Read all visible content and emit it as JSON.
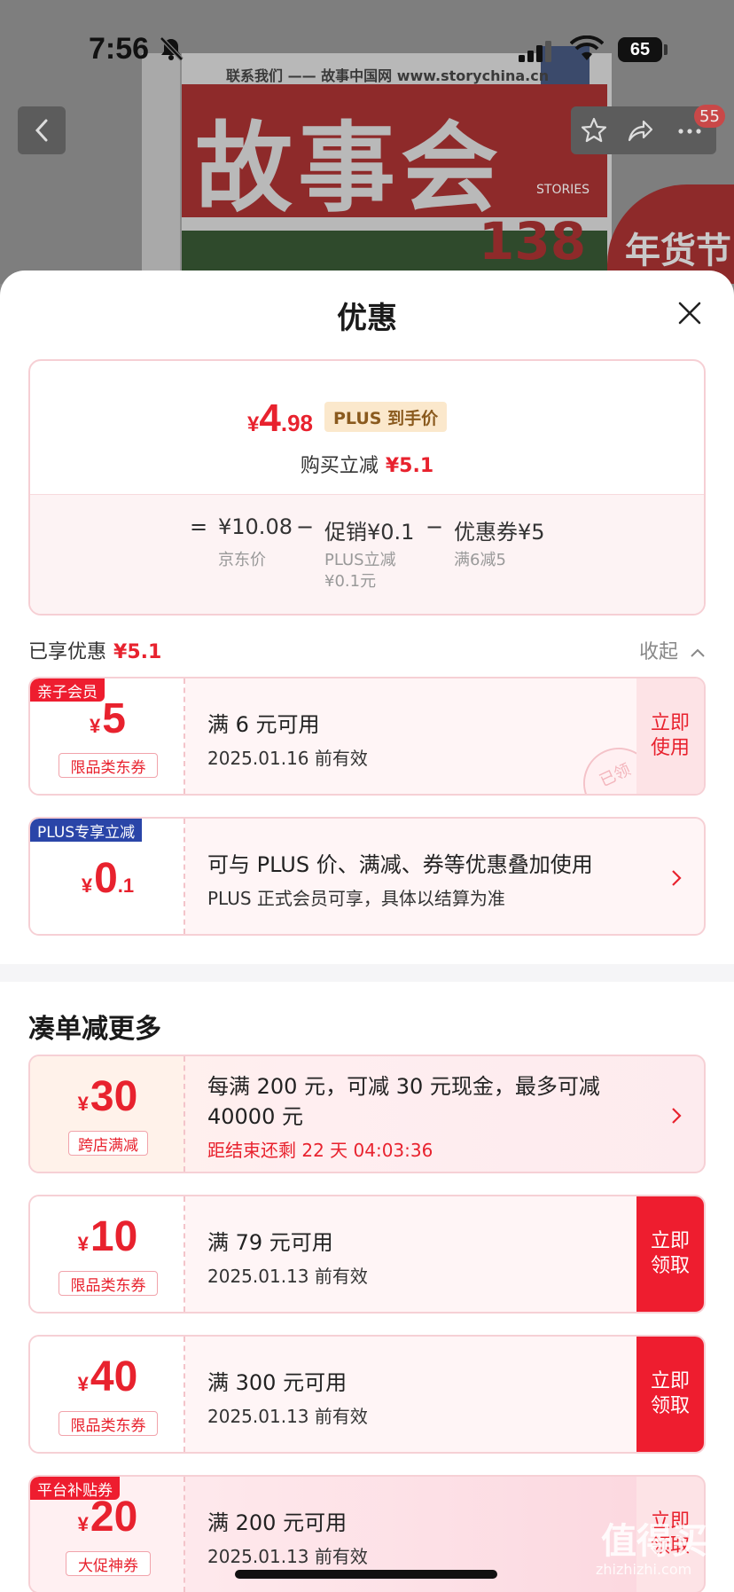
{
  "status_bar": {
    "time": "7:56",
    "battery": "65"
  },
  "nav": {
    "badge_count": "55"
  },
  "cover": {
    "site_text": "联系我们 —— 故事中国网 www.storychina.cn",
    "title": "故事会",
    "issue": "138",
    "badge": "年货节",
    "stories": "STORIES"
  },
  "sheet": {
    "title": "优惠"
  },
  "price": {
    "yen": "¥",
    "integer": "4",
    "decimal": ".98",
    "plus_tag": "PLUS 到手价",
    "buy_reduce_label": "购买立减",
    "buy_reduce_value": "¥5.1",
    "formula": {
      "equals": "=",
      "jd_price": "¥10.08",
      "jd_price_label": "京东价",
      "minus1": "−",
      "promo": "促销¥0.1",
      "promo_sub1": "PLUS立减",
      "promo_sub2": "¥0.1元",
      "minus2": "−",
      "coupon": "优惠券¥5",
      "coupon_sub": "满6减5"
    }
  },
  "enjoyed": {
    "label": "已享优惠",
    "value": "¥5.1",
    "collapse": "收起"
  },
  "coupons_enjoyed": [
    {
      "tag": "亲子会员",
      "yen": "¥",
      "num": "5",
      "kind": "限品类东券",
      "main": "满 6 元可用",
      "sub": "2025.01.16 前有效",
      "action": "立即使用",
      "stamp": "已领"
    },
    {
      "tag": "PLUS专享立减",
      "yen": "¥",
      "num": "0",
      "dec": ".1",
      "main": "可与 PLUS 价、满减、券等优惠叠加使用",
      "sub": "PLUS 正式会员可享，具体以结算为准"
    }
  ],
  "more": {
    "title": "凑单减更多"
  },
  "coupons_more": [
    {
      "yen": "¥",
      "num": "30",
      "kind": "跨店满减",
      "main1": "每满 200 元，可减 30 元现金，最多可减",
      "main2": "40000 元",
      "countdown": "距结束还剩 22 天 04:03:36"
    },
    {
      "yen": "¥",
      "num": "10",
      "kind": "限品类东券",
      "main": "满 79 元可用",
      "sub": "2025.01.13 前有效",
      "action": "立即领取"
    },
    {
      "yen": "¥",
      "num": "40",
      "kind": "限品类东券",
      "main": "满 300 元可用",
      "sub": "2025.01.13 前有效",
      "action": "立即领取"
    },
    {
      "tag": "平台补贴券",
      "yen": "¥",
      "num": "20",
      "kind": "大促神券",
      "main": "满 200 元可用",
      "sub": "2025.01.13 前有效",
      "action": "立即领取"
    }
  ],
  "watermark": {
    "text": "值得买",
    "sub": "zhizhizhi.com"
  },
  "colors": {
    "accent_red": "#e8222e",
    "button_red": "#ee1d2f",
    "tag_blue": "#2a45a8",
    "plus_gold": "#fbe8cc"
  }
}
